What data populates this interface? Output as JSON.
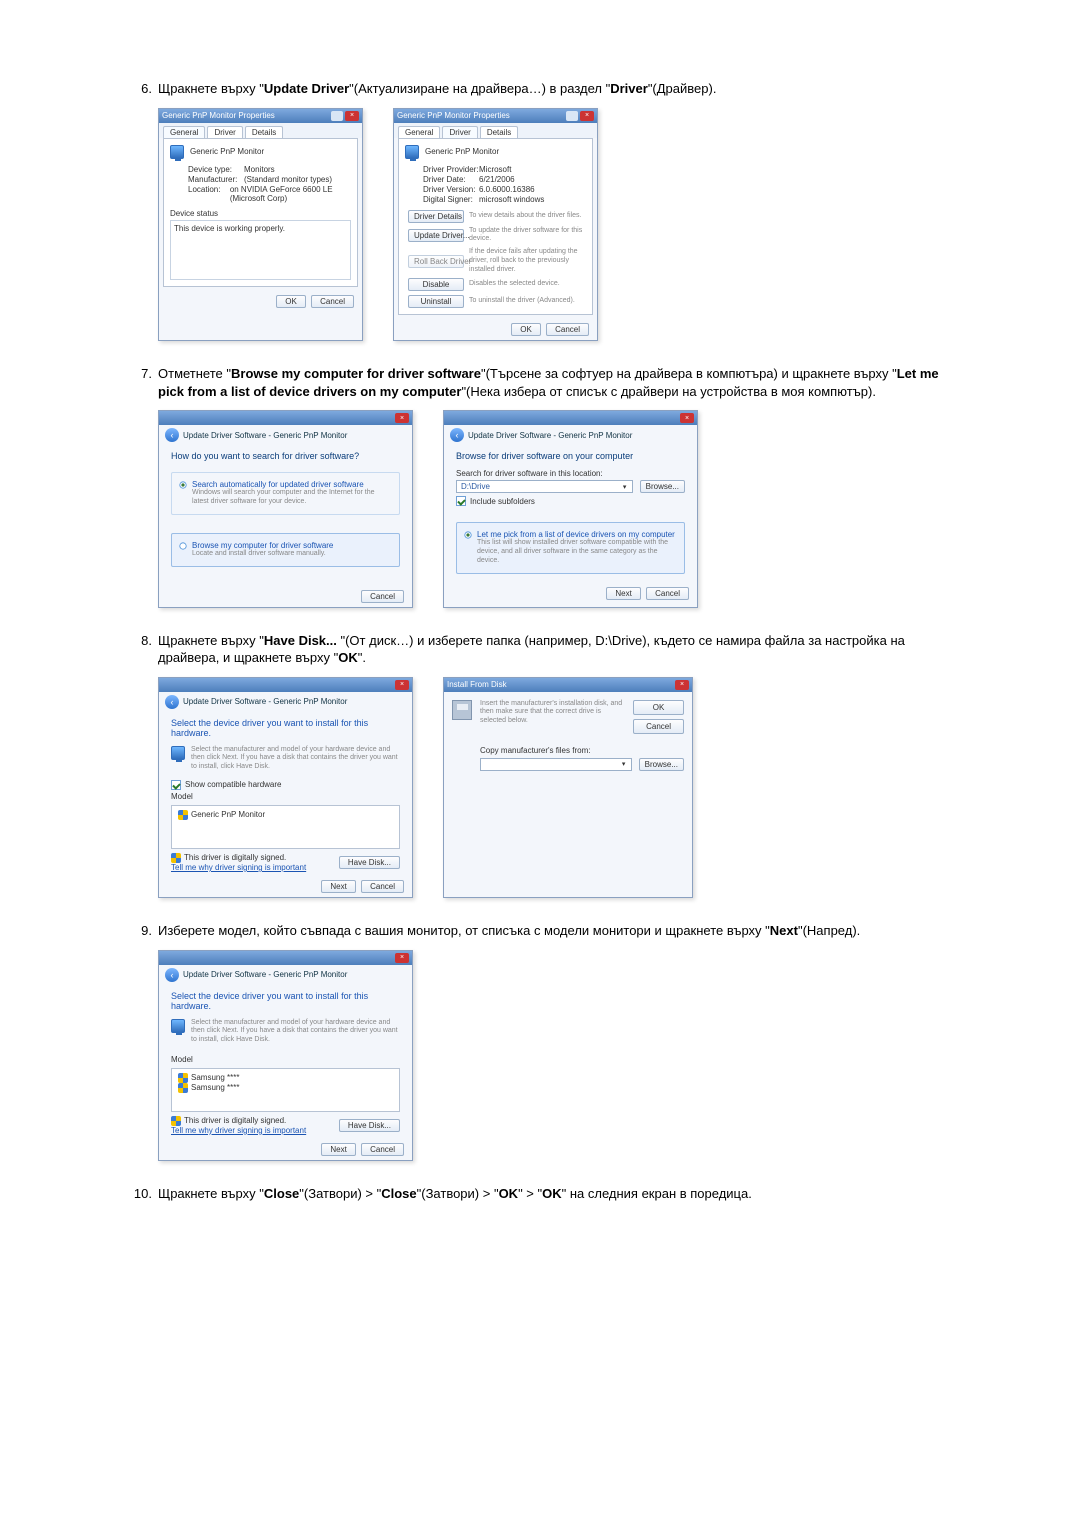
{
  "steps": {
    "s6": {
      "num": "6.",
      "text_a": "Щракнете върху \"",
      "bold_a": "Update Driver",
      "text_b": "\"(Актуализиране на драйвера…) в раздел \"",
      "bold_b": "Driver",
      "text_c": "\"(Драйвер)."
    },
    "s7": {
      "num": "7.",
      "text_a": "Отметнете \"",
      "bold_a": "Browse my computer for driver software",
      "text_b": "\"(Търсене за софтуер на драйвера в компютъра) и щракнете върху \"",
      "bold_b": "Let me pick from a list of device drivers on my computer",
      "text_c": "\"(Нека избера от списък с драйвери на устройства в моя компютър)."
    },
    "s8": {
      "num": "8.",
      "text_a": "Щракнете върху \"",
      "bold_a": "Have Disk... ",
      "text_b": "\"(От диск…) и изберете папка (например, D:\\Drive), където се намира файла за настройка на драйвера, и щракнете върху \"",
      "bold_b": "OK",
      "text_c": "\"."
    },
    "s9": {
      "num": "9.",
      "text_a": "Изберете модел, който съвпада с вашия монитор, от списъка с модели монитори и щракнете върху \"",
      "bold_a": "Next",
      "text_b": "\"(Напред)."
    },
    "s10": {
      "num": "10.",
      "text_a": "Щракнете върху \"",
      "bold_a": "Close",
      "text_b": "\"(Затвори) > \"",
      "bold_b": "Close",
      "text_c": "\"(Затвори) > \"",
      "bold_c": "OK",
      "text_d": "\" > \"",
      "bold_d": "OK",
      "text_e": "\" на следния екран в поредица."
    }
  },
  "dlg": {
    "prop_title": "Generic PnP Monitor Properties",
    "tab_general": "General",
    "tab_driver": "Driver",
    "tab_details": "Details",
    "mon_name": "Generic PnP Monitor",
    "dev_type_k": "Device type:",
    "dev_type_v": "Monitors",
    "manuf_k": "Manufacturer:",
    "manuf_v": "(Standard monitor types)",
    "loc_k": "Location:",
    "loc_v": "on NVIDIA GeForce 6600 LE (Microsoft Corp)",
    "status_h": "Device status",
    "status_txt": "This device is working properly.",
    "prov_k": "Driver Provider:",
    "prov_v": "Microsoft",
    "date_k": "Driver Date:",
    "date_v": "6/21/2006",
    "ver_k": "Driver Version:",
    "ver_v": "6.0.6000.16386",
    "signer_k": "Digital Signer:",
    "signer_v": "microsoft windows",
    "btn_details": "Driver Details",
    "btn_details_desc": "To view details about the driver files.",
    "btn_update": "Update Driver...",
    "btn_update_desc": "To update the driver software for this device.",
    "btn_rollback": "Roll Back Driver",
    "btn_rollback_desc": "If the device fails after updating the driver, roll back to the previously installed driver.",
    "btn_disable": "Disable",
    "btn_disable_desc": "Disables the selected device.",
    "btn_uninstall": "Uninstall",
    "btn_uninstall_desc": "To uninstall the driver (Advanced).",
    "ok": "OK",
    "cancel": "Cancel",
    "upd_title": "Update Driver Software - Generic PnP Monitor",
    "upd_q": "How do you want to search for driver software?",
    "upd_opt1_h": "Search automatically for updated driver software",
    "upd_opt1_t": "Windows will search your computer and the Internet for the latest driver software for your device.",
    "upd_opt2_h": "Browse my computer for driver software",
    "upd_opt2_t": "Locate and install driver software manually.",
    "browse_h": "Browse for driver software on your computer",
    "search_lbl": "Search for driver software in this location:",
    "search_val": "D:\\Drive",
    "include_sub": "Include subfolders",
    "browse_btn": "Browse...",
    "letme_h": "Let me pick from a list of device drivers on my computer",
    "letme_t": "This list will show installed driver software compatible with the device, and all driver software in the same category as the device.",
    "next": "Next",
    "back": "Back",
    "sel_h": "Select the device driver you want to install for this hardware.",
    "sel_t": "Select the manufacturer and model of your hardware device and then click Next. If you have a disk that contains the driver you want to install, click Have Disk.",
    "compat_lbl": "Show compatible hardware",
    "model_lbl": "Model",
    "model_item": "Generic PnP Monitor",
    "signed": "This driver is digitally signed.",
    "tellme": "Tell me why driver signing is important",
    "havedisk": "Have Disk...",
    "ifd_title": "Install From Disk",
    "ifd_text": "Insert the manufacturer's installation disk, and then make sure that the correct drive is selected below.",
    "ifd_copy": "Copy manufacturer's files from:",
    "s9_m1": "Samsung ****",
    "s9_m2": "Samsung ****"
  }
}
